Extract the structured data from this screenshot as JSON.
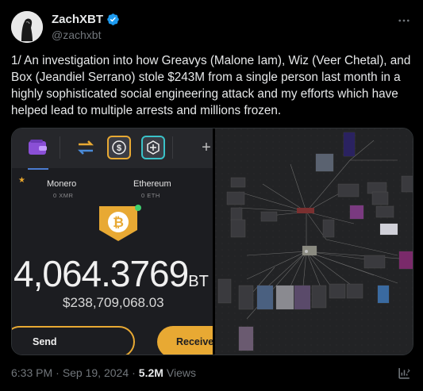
{
  "author": {
    "display_name": "ZachXBT",
    "handle": "@zachxbt",
    "verified": true,
    "verified_color": "#1d9bf0"
  },
  "tweet": {
    "text": "1/ An investigation into how Greavys (Malone Iam), Wiz (Veer Chetal), and Box (Jeandiel Serrano) stole $243M from a single person last month in a highly sophisticated social engineering attack and my efforts which have helped lead to multiple arrests and millions frozen."
  },
  "media": {
    "wallet": {
      "tab_icons": [
        "wallet-icon",
        "swap-arrows-icon",
        "dollar-coin-icon",
        "crypto-box-icon",
        "plus-icon"
      ],
      "coins": [
        {
          "name": "Monero",
          "amount": "0 XMR"
        },
        {
          "name": "Ethereum",
          "amount": "0 ETH"
        }
      ],
      "balance": "4,064.3769",
      "balance_unit": "BT",
      "usd_balance": "$238,709,068.03",
      "send_label": "Send",
      "receive_label": "Receive",
      "accent_color": "#e8a933"
    },
    "graph": {
      "description_icon": "investigation-graph-image"
    }
  },
  "meta": {
    "time": "6:33 PM",
    "date": "Sep 19, 2024",
    "views_count": "5.2M",
    "views_label": "Views"
  }
}
